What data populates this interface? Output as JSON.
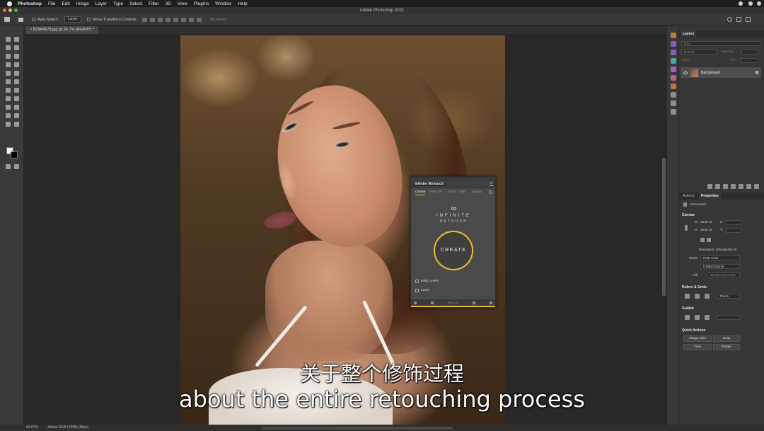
{
  "menubar": {
    "app_name": "Photoshop",
    "items": [
      "File",
      "Edit",
      "Image",
      "Layer",
      "Type",
      "Select",
      "Filter",
      "3D",
      "View",
      "Plugins",
      "Window",
      "Help"
    ]
  },
  "window": {
    "title": "Adobe Photoshop 2021"
  },
  "options_bar": {
    "auto_select_label": "Auto-Select:",
    "auto_select_value": "Layer",
    "show_transform_label": "Show Transform Controls",
    "mode_3d": "3D Mode:"
  },
  "document_tab": {
    "label": "B29A4678.jpg @ 66.7% (RGB/8*) *"
  },
  "infinite_retouch": {
    "title": "Infinite Retouch",
    "tabs": [
      "Create",
      "Retouch",
      "Tools",
      "Utils",
      "Layout"
    ],
    "logo_top": "INFINITE",
    "logo_bottom": "RETOUCH",
    "create_label": "CREATE",
    "options": [
      "Help Levels",
      "Level"
    ],
    "bottom_letters": "H  S  L  C"
  },
  "layers_panel": {
    "tab": "Layers",
    "search_placeholder": "Kind",
    "blend_mode": "Normal",
    "opacity_label": "Opacity:",
    "lock_label": "Lock:",
    "fill_label": "Fill:",
    "layer_name": "Background"
  },
  "properties_panel": {
    "tabs": [
      "Actions",
      "Properties"
    ],
    "document_label": "Document",
    "canvas_section": "Canvas",
    "width_label": "W",
    "width_value": "1638 px",
    "height_label": "H",
    "height_value": "2048 px",
    "x_label": "X",
    "y_label": "Y",
    "resolution": "Resolution: 300 pixels/inch",
    "mode_label": "Mode",
    "mode_value": "RGB Color",
    "bit_depth": "8 Bits/Channel",
    "fill_label": "Fill",
    "fill_value": "Background Color",
    "rulers_section": "Rulers & Grids",
    "units_value": "Pixels",
    "guides_section": "Guides",
    "quick_actions_section": "Quick Actions",
    "quick_actions": [
      "Image Size",
      "Crop",
      "Trim",
      "Rotate"
    ]
  },
  "status_bar": {
    "zoom": "66.67%",
    "profile": "Adobe RGB (1998) (8bpc)"
  },
  "subtitles": {
    "chinese": "关于整个修饰过程",
    "english": "about the entire retouching process"
  },
  "colors": {
    "accent": "#f0bb2c",
    "panel_bg": "#363636",
    "canvas_bg": "#282828"
  }
}
